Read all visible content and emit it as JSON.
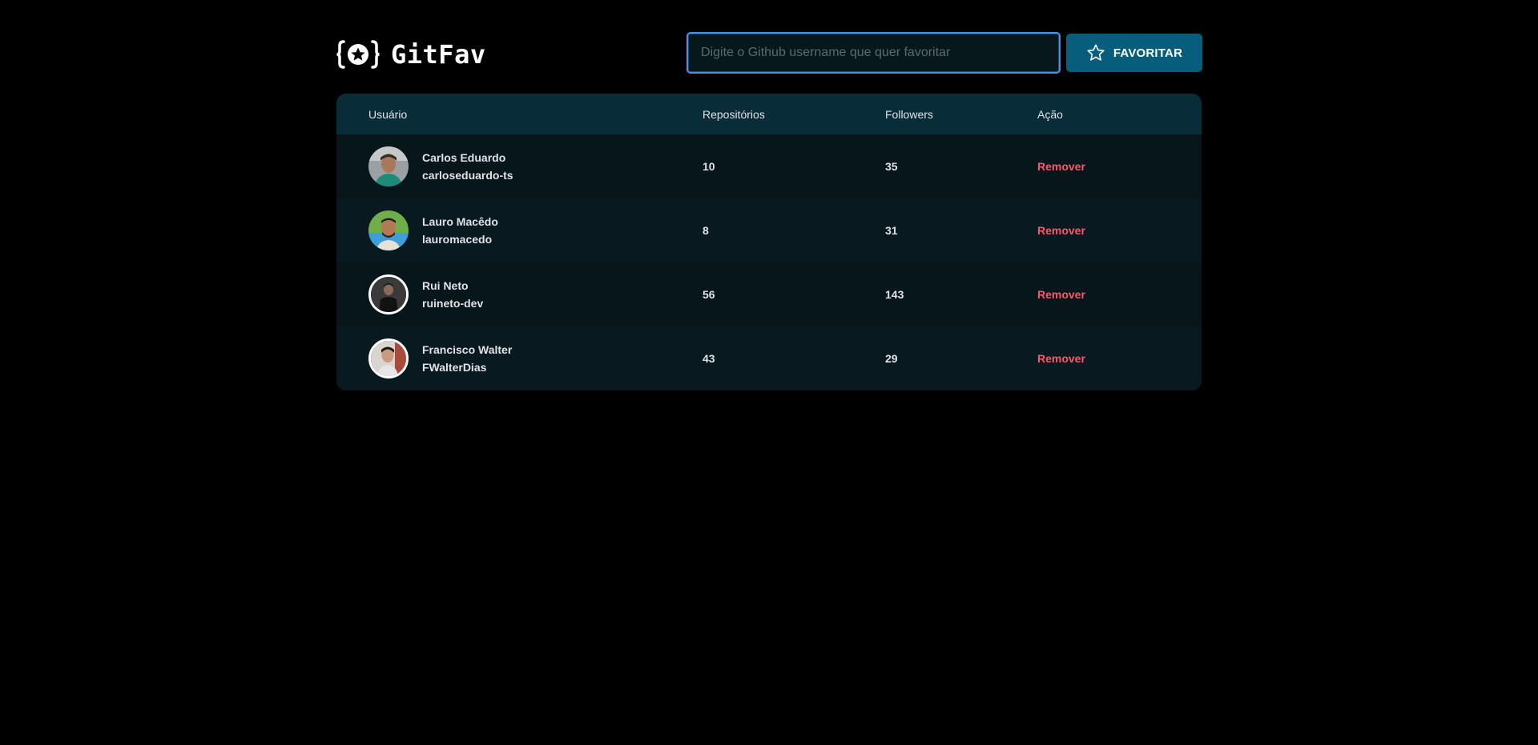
{
  "app": {
    "title": "GitFav"
  },
  "search": {
    "placeholder": "Digite o Github username que quer favoritar",
    "value": ""
  },
  "favorite_button": {
    "label": "FAVORITAR",
    "icon": "star-icon"
  },
  "table": {
    "headers": {
      "user": "Usuário",
      "repos": "Repositórios",
      "followers": "Followers",
      "action": "Ação"
    },
    "rows": [
      {
        "name": "Carlos Eduardo",
        "login": "carloseduardo-ts",
        "repos": "10",
        "followers": "35",
        "action": "Remover"
      },
      {
        "name": "Lauro Macêdo",
        "login": "lauromacedo",
        "repos": "8",
        "followers": "31",
        "action": "Remover"
      },
      {
        "name": "Rui Neto",
        "login": "ruineto-dev",
        "repos": "56",
        "followers": "143",
        "action": "Remover"
      },
      {
        "name": "Francisco Walter",
        "login": "FWalterDias",
        "repos": "43",
        "followers": "29",
        "action": "Remover"
      }
    ]
  },
  "colors": {
    "background": "#000000",
    "header_row": "#092D38",
    "row_dark": "#06161B",
    "row_light": "#081A20",
    "button": "#065E7C",
    "input_border": "#4A90E2",
    "remove": "#F75A68"
  }
}
